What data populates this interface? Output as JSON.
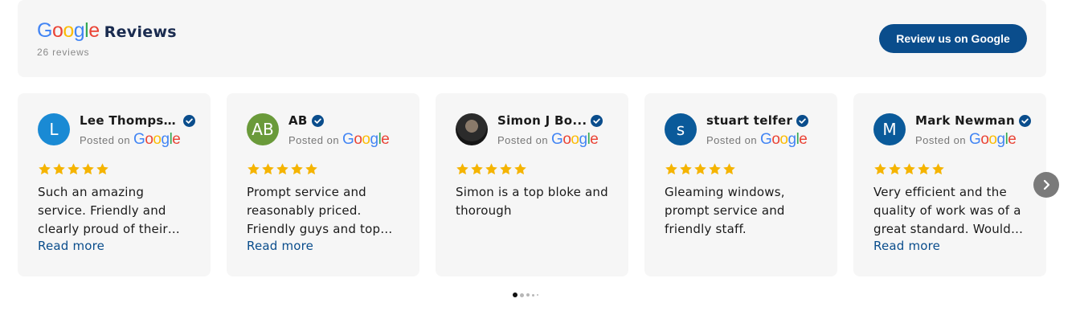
{
  "header": {
    "logo_text": "Google",
    "title": "Reviews",
    "review_count": "26 reviews",
    "cta_label": "Review us on Google"
  },
  "colors": {
    "primary": "#0a4d8c",
    "star": "#f5b400",
    "google_blue": "#4285F4",
    "google_red": "#EA4335",
    "google_yellow": "#FBBC05",
    "google_green": "#34A853"
  },
  "reviews": [
    {
      "name": "Lee Thompson",
      "avatar_text": "L",
      "avatar_color": "#1a8ad4",
      "posted_label": "Posted on",
      "platform": "Google",
      "rating": 5,
      "text": "Such an amazing service. Friendly and clearly proud of their work. Would highly recommend.",
      "read_more": "Read more"
    },
    {
      "name": "AB",
      "avatar_text": "AB",
      "avatar_color": "#6a9a3a",
      "avatar_badge": true,
      "posted_label": "Posted on",
      "platform": "Google",
      "rating": 5,
      "text": "Prompt service and reasonably priced. Friendly guys and top job done.",
      "read_more": "Read more"
    },
    {
      "name": "Simon J Bo...",
      "avatar_text": "",
      "avatar_color": "#222222",
      "avatar_photo": true,
      "avatar_badge": true,
      "posted_label": "Posted on",
      "platform": "Google",
      "rating": 5,
      "text": "Simon is a top bloke and thorough",
      "read_more": ""
    },
    {
      "name": "stuart telfer",
      "avatar_text": "s",
      "avatar_color": "#0a5a9a",
      "posted_label": "Posted on",
      "platform": "Google",
      "rating": 5,
      "text": "Gleaming windows, prompt service and friendly staff.",
      "read_more": ""
    },
    {
      "name": "Mark Newman",
      "avatar_text": "M",
      "avatar_color": "#0a5a9a",
      "posted_label": "Posted on",
      "platform": "Google",
      "rating": 5,
      "text": "Very efficient and the quality of work was of a great standard. Would recommend.",
      "read_more": "Read more"
    }
  ],
  "pagination": {
    "active_index": 0,
    "count": 5
  },
  "next_icon": "chevron-right-icon"
}
